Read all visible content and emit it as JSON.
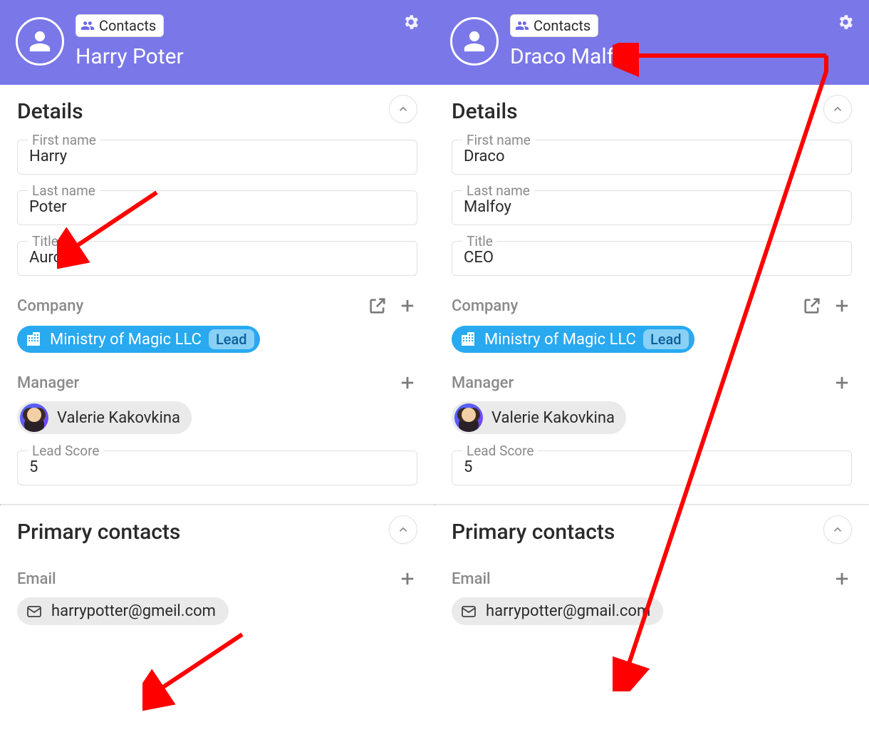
{
  "shared": {
    "contacts_chip": "Contacts",
    "sections": {
      "details": "Details",
      "primary_contacts": "Primary contacts"
    },
    "labels": {
      "first_name": "First name",
      "last_name": "Last name",
      "title": "Title",
      "company": "Company",
      "manager": "Manager",
      "lead_score": "Lead Score",
      "email": "Email"
    }
  },
  "panels": [
    {
      "name": "Harry Poter",
      "first_name": "Harry",
      "last_name": "Poter",
      "title": "Auror",
      "company": {
        "name": "Ministry of Magic LLC",
        "status": "Lead"
      },
      "manager": "Valerie Kakovkina",
      "lead_score": "5",
      "email": "harrypotter@gmeil.com"
    },
    {
      "name": "Draco Malfoy",
      "first_name": "Draco",
      "last_name": "Malfoy",
      "title": "CEO",
      "company": {
        "name": "Ministry of Magic LLC",
        "status": "Lead"
      },
      "manager": "Valerie Kakovkina",
      "lead_score": "5",
      "email": "harrypotter@gmail.com"
    }
  ]
}
